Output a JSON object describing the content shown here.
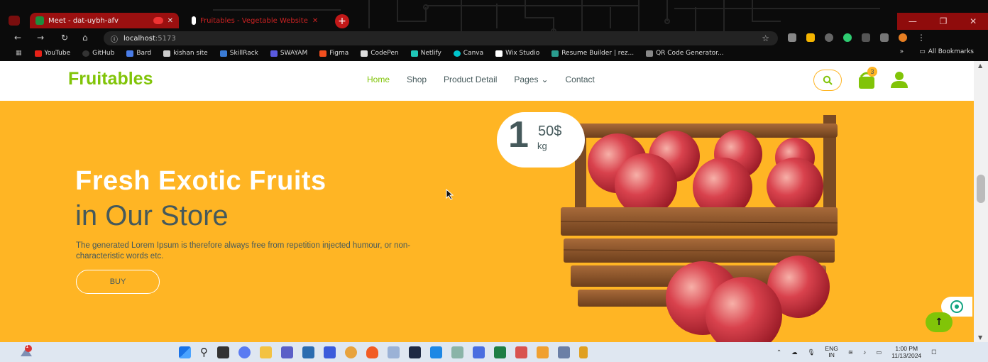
{
  "browser": {
    "tabs": [
      {
        "title": "Meet - dat-uybh-afv",
        "active": true
      },
      {
        "title": "Fruitables - Vegetable Website",
        "active": false
      }
    ],
    "address": {
      "host": "localhost",
      "port": ":5173"
    },
    "bookmarks": [
      {
        "label": "YouTube",
        "color": "#e62117"
      },
      {
        "label": "GitHub",
        "color": "#333333"
      },
      {
        "label": "Bard",
        "color": "#4a7de8"
      },
      {
        "label": "kishan site",
        "color": "#cccccc"
      },
      {
        "label": "SkillRack",
        "color": "#3a7bd5"
      },
      {
        "label": "SWAYAM",
        "color": "#5a5ae0"
      },
      {
        "label": "Figma",
        "color": "#f24e1e"
      },
      {
        "label": "CodePen",
        "color": "#dddddd"
      },
      {
        "label": "Netlify",
        "color": "#20c6b7"
      },
      {
        "label": "Canva",
        "color": "#00c4cc"
      },
      {
        "label": "Wix Studio",
        "color": "#ffffff"
      },
      {
        "label": "Resume Builder | rez...",
        "color": "#2a9d8f"
      },
      {
        "label": "QR Code Generator...",
        "color": "#888888"
      }
    ],
    "all_bookmarks": "All Bookmarks",
    "more": "»"
  },
  "site": {
    "logo": "Fruitables",
    "nav": [
      "Home",
      "Shop",
      "Product Detail",
      "Pages",
      "Contact"
    ],
    "cart_count": "3",
    "colors": {
      "primary": "#81c408",
      "secondary": "#ffb524",
      "dark": "#45595b"
    }
  },
  "hero": {
    "title_line1": "Fresh Exotic Fruits",
    "title_line2": "in Our Store",
    "description": "The generated Lorem Ipsum is therefore always free from repetition injected humour, or non-characteristic words etc.",
    "button": "BUY",
    "price_main": "1",
    "price_fraction": "50$",
    "price_unit": "kg"
  },
  "taskbar": {
    "lang_top": "ENG",
    "lang_bottom": "IN",
    "time": "1:00 PM",
    "date": "11/13/2024",
    "notification_count": "1"
  }
}
